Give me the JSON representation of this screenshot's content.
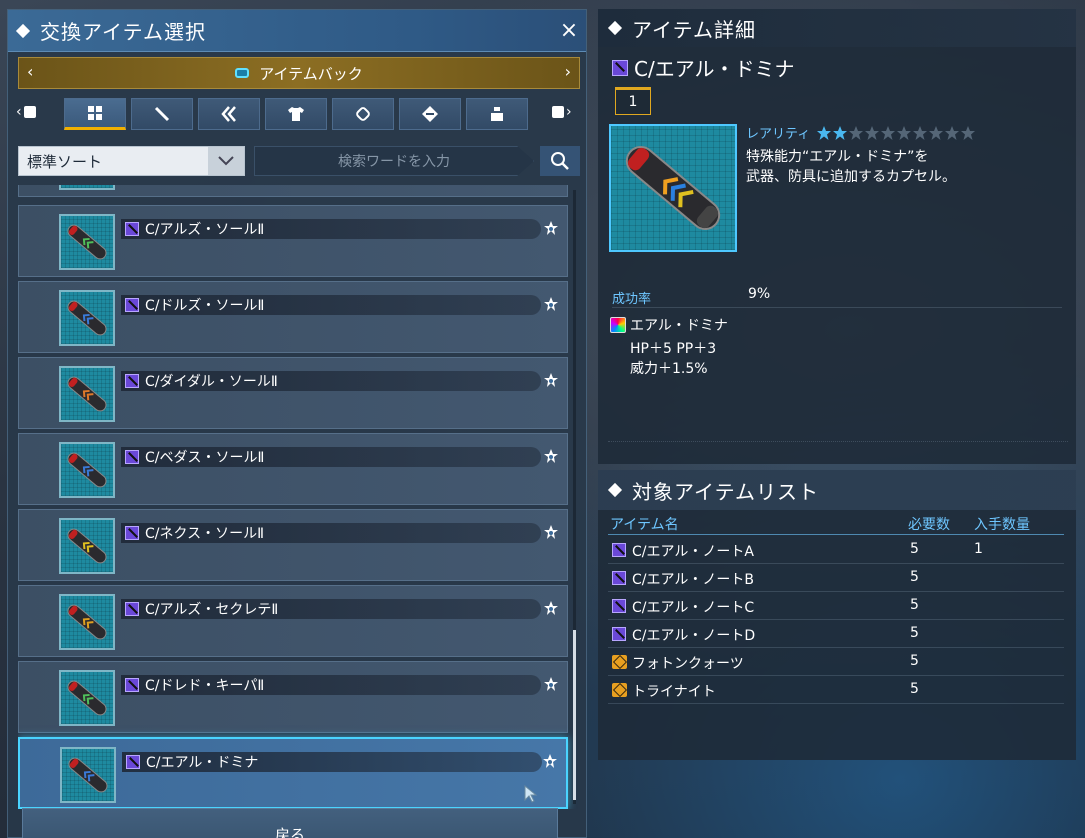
{
  "left_panel": {
    "title": "交換アイテム選択",
    "close_label": "×",
    "bag_label": "アイテムバック",
    "category_tabs": [
      {
        "icon": "grid-icon",
        "active": true
      },
      {
        "icon": "sword-icon",
        "active": false
      },
      {
        "icon": "double-chevron-icon",
        "active": false
      },
      {
        "icon": "shirt-icon",
        "active": false
      },
      {
        "icon": "tag-icon",
        "active": false
      },
      {
        "icon": "arrows-icon",
        "active": false
      },
      {
        "icon": "consumable-icon",
        "active": false
      }
    ],
    "sort_value": "標準ソート",
    "search_placeholder": "検索ワードを入力",
    "items": [
      {
        "name": "C/アルズ・ソールⅡ",
        "accent": "#4fbf5a"
      },
      {
        "name": "C/ドルズ・ソールⅡ",
        "accent": "#3a7ad8"
      },
      {
        "name": "C/ダイダル・ソールⅡ",
        "accent": "#e07a2a"
      },
      {
        "name": "C/ベダス・ソールⅡ",
        "accent": "#3a7ad8"
      },
      {
        "name": "C/ネクス・ソールⅡ",
        "accent": "#e0c020"
      },
      {
        "name": "C/アルズ・セクレテⅡ",
        "accent": "#e0a020"
      },
      {
        "name": "C/ドレド・キーパⅡ",
        "accent": "#4fbf5a"
      },
      {
        "name": "C/エアル・ドミナ",
        "accent": "#3a7ad8"
      }
    ],
    "back_label": "戻る"
  },
  "detail_panel": {
    "title": "アイテム詳細",
    "item_name": "C/エアル・ドミナ",
    "level": "1",
    "rarity_label": "レアリティ",
    "rarity_stars": 2,
    "rarity_max": 10,
    "description_line1": "特殊能力“エアル・ドミナ”を",
    "description_line2": "武器、防具に追加するカプセル。",
    "success_label": "成功率",
    "success_value": "9%",
    "effect_name": "エアル・ドミナ",
    "effect_line1": "HP＋5 PP＋3",
    "effect_line2": "威力＋1.5%"
  },
  "target_panel": {
    "title": "対象アイテムリスト",
    "headers": {
      "name": "アイテム名",
      "required": "必要数",
      "owned": "入手数量"
    },
    "rows": [
      {
        "icon": "capsule-icon",
        "name": "C/エアル・ノートA",
        "required": "5",
        "owned": "1"
      },
      {
        "icon": "capsule-icon",
        "name": "C/エアル・ノートB",
        "required": "5",
        "owned": ""
      },
      {
        "icon": "capsule-icon",
        "name": "C/エアル・ノートC",
        "required": "5",
        "owned": ""
      },
      {
        "icon": "capsule-icon",
        "name": "C/エアル・ノートD",
        "required": "5",
        "owned": ""
      },
      {
        "icon": "gem-icon",
        "name": "フォトンクォーツ",
        "required": "5",
        "owned": ""
      },
      {
        "icon": "gem-icon",
        "name": "トライナイト",
        "required": "5",
        "owned": ""
      }
    ]
  },
  "colors": {
    "accent": "#4ad4ff",
    "gold": "#e0a820",
    "label_blue": "#6ec6ff"
  }
}
